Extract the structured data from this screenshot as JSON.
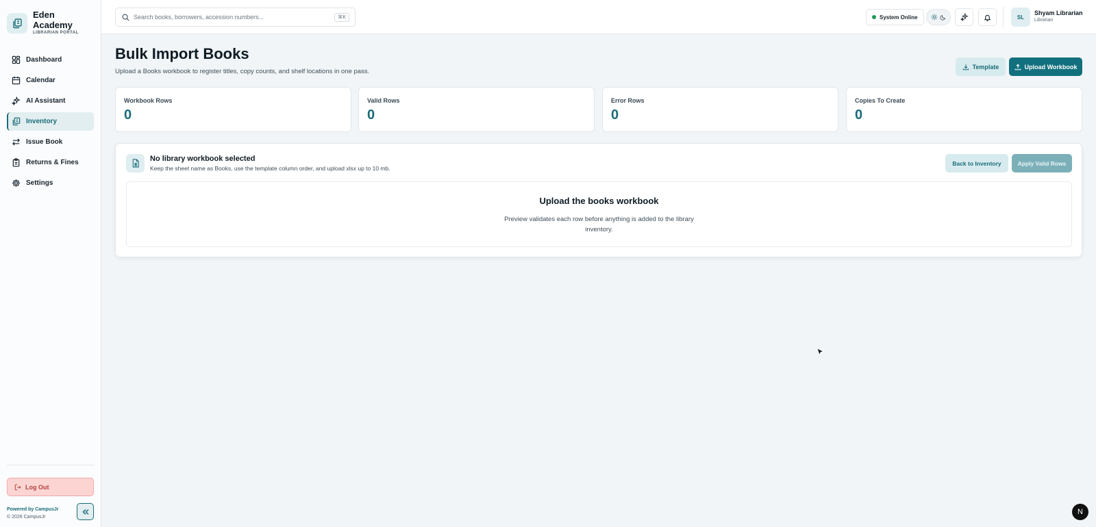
{
  "brand": {
    "name": "Eden Academy",
    "portal": "LIBRARIAN PORTAL"
  },
  "sidebar": {
    "items": [
      {
        "label": "Dashboard",
        "icon": "grid-icon",
        "active": false
      },
      {
        "label": "Calendar",
        "icon": "calendar-icon",
        "active": false
      },
      {
        "label": "AI Assistant",
        "icon": "sparkles-icon",
        "active": false
      },
      {
        "label": "Inventory",
        "icon": "books-icon",
        "active": true
      },
      {
        "label": "Issue Book",
        "icon": "swap-arrows-icon",
        "active": false
      },
      {
        "label": "Returns & Fines",
        "icon": "clipboard-icon",
        "active": false
      },
      {
        "label": "Settings",
        "icon": "gear-icon",
        "active": false
      }
    ],
    "logout_label": "Log Out",
    "powered_by": "Powered by CampusJr",
    "copyright": "© 2026 CampusJr"
  },
  "topbar": {
    "search_placeholder": "Search books, borrowers, accession numbers...",
    "shortcut": "⌘K",
    "status_label": "System Online",
    "user_initials": "SL",
    "user_name": "Shyam Librarian",
    "user_role": "Librarian"
  },
  "page": {
    "title": "Bulk Import Books",
    "subtitle": "Upload a Books workbook to register titles, copy counts, and shelf locations in one pass.",
    "template_button": "Template",
    "upload_button": "Upload Workbook"
  },
  "stats": [
    {
      "label": "Workbook Rows",
      "value": "0"
    },
    {
      "label": "Valid Rows",
      "value": "0"
    },
    {
      "label": "Error Rows",
      "value": "0"
    },
    {
      "label": "Copies To Create",
      "value": "0"
    }
  ],
  "panel": {
    "title": "No library workbook selected",
    "description": "Keep the sheet name as Books, use the template column order, and upload xlsx up to 10 mb.",
    "back_button": "Back to Inventory",
    "apply_button": "Apply Valid Rows",
    "drop_title": "Upload the books workbook",
    "drop_description": "Preview validates each row before anything is added to the library inventory."
  },
  "colors": {
    "accent": "#12707e",
    "accent_soft": "#d7ebee",
    "status_online": "#1e9a5a",
    "logout_bg": "#fcd5d3"
  },
  "floating_badge": "N"
}
